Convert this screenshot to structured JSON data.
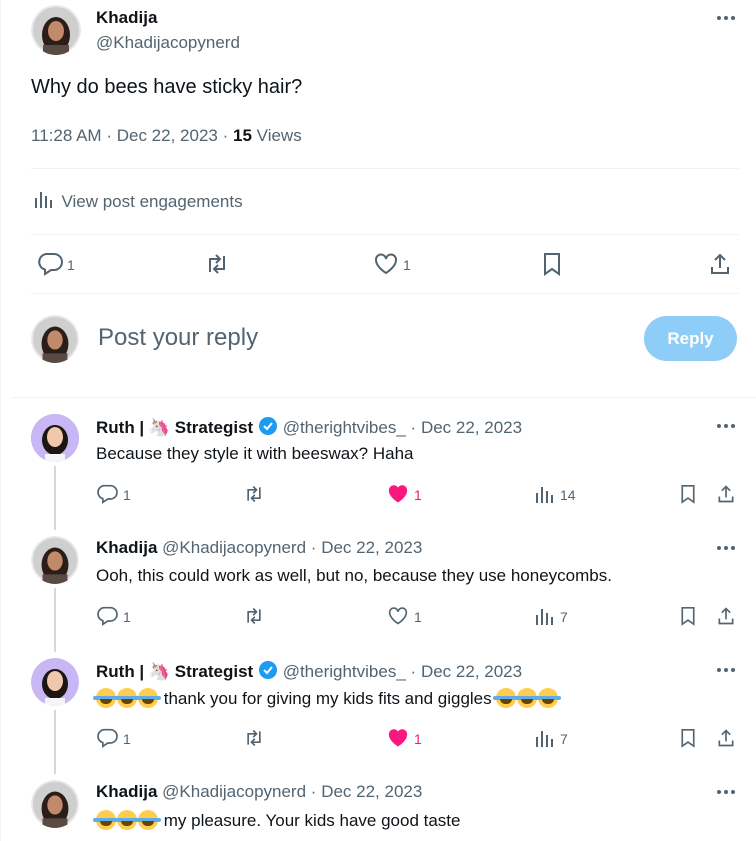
{
  "post": {
    "author_name": "Khadija",
    "author_handle": "@Khadijacopynerd",
    "text": "Why do bees have sticky hair?",
    "time": "11:28 AM",
    "date": "Dec 22, 2023",
    "views_count": "15",
    "views_label": "Views",
    "engagements_label": "View post engagements",
    "actions": {
      "replies": "1",
      "likes": "1"
    }
  },
  "composer": {
    "placeholder": "Post your reply",
    "button_label": "Reply"
  },
  "replies": [
    {
      "author_name": "Ruth | 🦄 Strategist",
      "handle": "@therightvibes_",
      "date": "Dec 22, 2023",
      "text": "Because they style it with beeswax? Haha",
      "replies": "1",
      "likes": "1",
      "views": "14",
      "liked": true
    },
    {
      "author_name": "Khadija",
      "handle": "@Khadijacopynerd",
      "date": "Dec 22, 2023",
      "text": "Ooh, this could work as well, but no, because they use honeycombs.",
      "replies": "1",
      "likes": "1",
      "views": "7",
      "liked": false
    },
    {
      "author_name": "Ruth | 🦄 Strategist",
      "handle": "@therightvibes_",
      "date": "Dec 22, 2023",
      "text": "thank you for giving my kids fits and giggles",
      "replies": "1",
      "likes": "1",
      "views": "7",
      "liked": true
    },
    {
      "author_name": "Khadija",
      "handle": "@Khadijacopynerd",
      "date": "Dec 22, 2023",
      "text": "my pleasure. Your kids have good taste"
    }
  ],
  "separator": "·",
  "colors": {
    "accent": "#1d9bf0",
    "like": "#f91880",
    "muted": "#536471",
    "reply_button": "#8ecdf8"
  },
  "icons": [
    "more-icon",
    "bar-chart-icon",
    "reply-icon",
    "retweet-icon",
    "heart-icon",
    "bookmark-icon",
    "share-icon",
    "verified-icon",
    "views-icon"
  ]
}
